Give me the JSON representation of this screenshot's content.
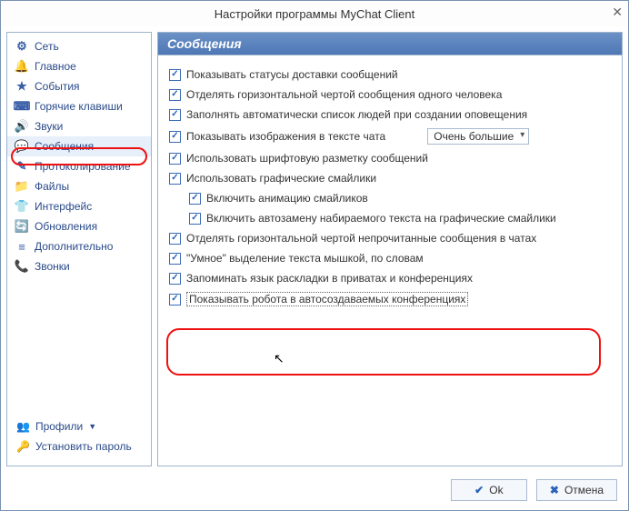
{
  "window": {
    "title": "Настройки программы MyChat Client"
  },
  "sidebar": {
    "items": [
      {
        "icon": "⚙",
        "label": "Сеть"
      },
      {
        "icon": "🔔",
        "label": "Главное"
      },
      {
        "icon": "★",
        "label": "События"
      },
      {
        "icon": "⌨",
        "label": "Горячие клавиши"
      },
      {
        "icon": "🔊",
        "label": "Звуки"
      },
      {
        "icon": "💬",
        "label": "Сообщения"
      },
      {
        "icon": "✎",
        "label": "Протоколирование"
      },
      {
        "icon": "📁",
        "label": "Файлы"
      },
      {
        "icon": "👕",
        "label": "Интерфейс"
      },
      {
        "icon": "🔄",
        "label": "Обновления"
      },
      {
        "icon": "≡",
        "label": "Дополнительно"
      },
      {
        "icon": "📞",
        "label": "Звонки"
      }
    ],
    "profiles": "Профили",
    "set_password": "Установить пароль"
  },
  "content": {
    "header": "Сообщения",
    "options": {
      "show_delivery_status": "Показывать статусы доставки сообщений",
      "separate_line_per_person": "Отделять горизонтальной чертой сообщения одного человека",
      "auto_fill_people_list": "Заполнять автоматически список людей при создании оповещения",
      "show_images_in_chat": "Показывать изображения в тексте чата",
      "image_size_value": "Очень большие",
      "use_font_markup": "Использовать шрифтовую разметку сообщений",
      "use_graphic_smilies": "Использовать графические смайлики",
      "enable_smilies_animation": "Включить анимацию смайликов",
      "enable_smilies_autoreplace": "Включить автозамену набираемого текста на графические смайлики",
      "separate_unread_line": "Отделять горизонтальной чертой непрочитанные сообщения в чатах",
      "smart_text_select": "\"Умное\" выделение текста мышкой, по словам",
      "remember_keyboard_layout": "Запоминать язык раскладки в приватах и конференциях",
      "show_robot_in_auto_conf": "Показывать робота в автосоздаваемых конференциях"
    }
  },
  "footer": {
    "ok": "Ok",
    "cancel": "Отмена"
  }
}
